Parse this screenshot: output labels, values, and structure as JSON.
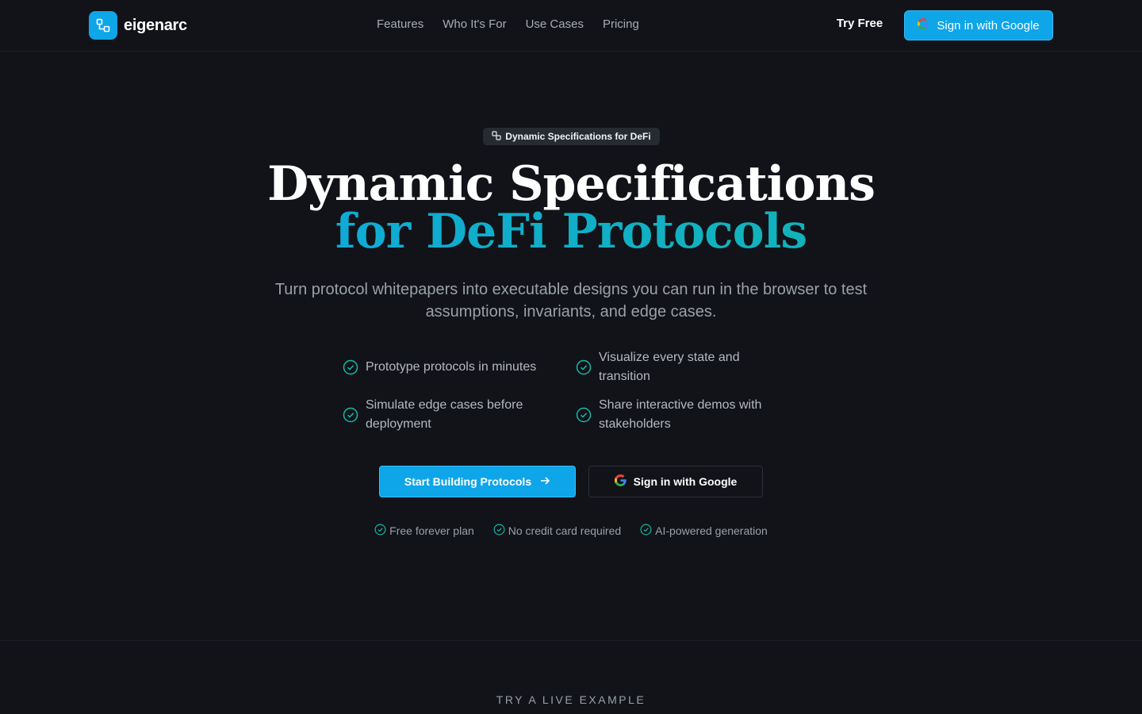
{
  "header": {
    "brand_name": "eigenarc",
    "nav": [
      {
        "label": "Features"
      },
      {
        "label": "Who It's For"
      },
      {
        "label": "Use Cases"
      },
      {
        "label": "Pricing"
      }
    ],
    "try_free": "Try Free",
    "google_signin": "Sign in with Google"
  },
  "hero": {
    "badge": "Dynamic Specifications for DeFi",
    "headline_line1": "Dynamic Specifications",
    "headline_line2": "for DeFi Protocols",
    "subtext": "Turn protocol whitepapers into executable designs you can run in the browser to test assumptions, invariants, and edge cases.",
    "features": [
      {
        "text": "Prototype protocols in minutes"
      },
      {
        "text": "Visualize every state and transition"
      },
      {
        "text": "Simulate edge cases before deployment"
      },
      {
        "text": "Share interactive demos with stakeholders"
      }
    ],
    "cta_primary": "Start Building Protocols",
    "cta_secondary": "Sign in with Google",
    "perks": [
      {
        "text": "Free forever plan"
      },
      {
        "text": "No credit card required"
      },
      {
        "text": "AI-powered generation"
      }
    ]
  },
  "section": {
    "label": "TRY A LIVE EXAMPLE"
  },
  "colors": {
    "background": "#111318",
    "accent": "#0ea5e9",
    "accent_teal": "#14b8a6",
    "text_muted": "#9aa0a9"
  },
  "icons": {
    "brand": "network-nodes-icon",
    "badge": "link-icon",
    "feature": "check-circle-icon",
    "cta_primary": "arrow-right-icon",
    "google": "google-icon"
  }
}
